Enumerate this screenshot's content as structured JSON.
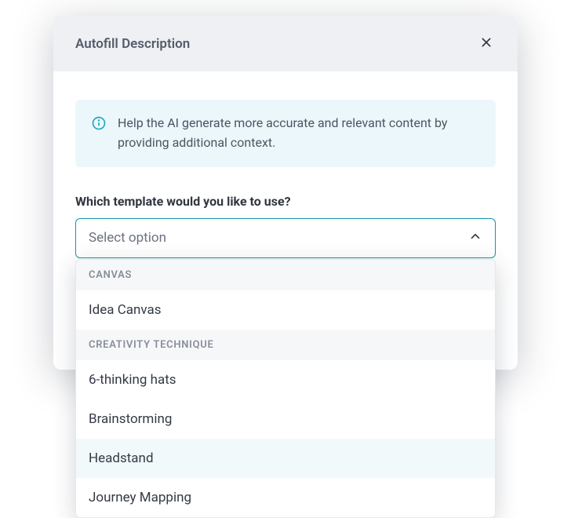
{
  "modal": {
    "title": "Autofill Description",
    "info_text": "Help the AI generate more accurate and relevant content by providing additional context."
  },
  "form": {
    "template_label": "Which template would you like to use?",
    "select_placeholder": "Select option"
  },
  "dropdown": {
    "groups": [
      {
        "header": "CANVAS",
        "options": [
          {
            "label": "Idea Canvas",
            "highlighted": false
          }
        ]
      },
      {
        "header": "CREATIVITY TECHNIQUE",
        "options": [
          {
            "label": "6-thinking hats",
            "highlighted": false
          },
          {
            "label": "Brainstorming",
            "highlighted": false
          },
          {
            "label": "Headstand",
            "highlighted": true
          },
          {
            "label": "Journey Mapping",
            "highlighted": false
          }
        ]
      }
    ]
  }
}
